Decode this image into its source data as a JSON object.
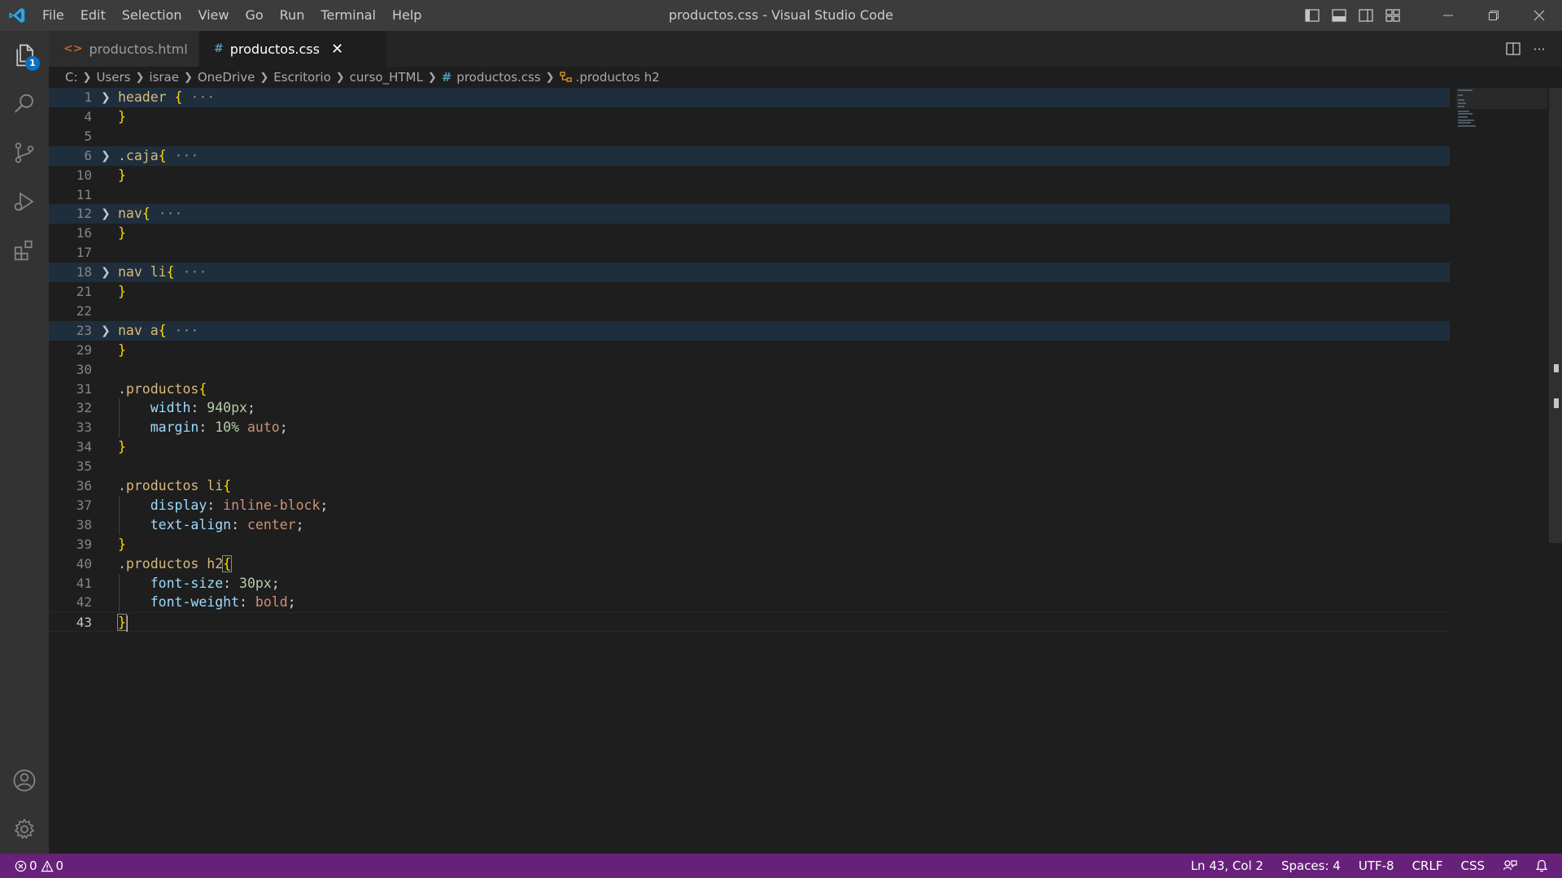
{
  "titlebar": {
    "menu": [
      "File",
      "Edit",
      "Selection",
      "View",
      "Go",
      "Run",
      "Terminal",
      "Help"
    ],
    "window_title": "productos.css - Visual Studio Code"
  },
  "activity_bar": {
    "explorer_badge": "1"
  },
  "tabs": [
    {
      "icon": "<>",
      "label": "productos.html",
      "modified": true,
      "active": false
    },
    {
      "icon": "#",
      "label": "productos.css",
      "modified": false,
      "active": true
    }
  ],
  "breadcrumb": [
    "C:",
    "Users",
    "israe",
    "OneDrive",
    "Escritorio",
    "curso_HTML",
    "productos.css",
    ".productos h2"
  ],
  "editor": {
    "lines": [
      {
        "num": "1",
        "folded": true,
        "tokens": [
          [
            "sel",
            "header "
          ],
          [
            "brace",
            "{"
          ],
          [
            "fold",
            " ···"
          ]
        ]
      },
      {
        "num": "4",
        "tokens": [
          [
            "brace",
            "}"
          ]
        ]
      },
      {
        "num": "5",
        "tokens": []
      },
      {
        "num": "6",
        "folded": true,
        "tokens": [
          [
            "sel",
            ".caja"
          ],
          [
            "brace",
            "{"
          ],
          [
            "fold",
            " ···"
          ]
        ]
      },
      {
        "num": "10",
        "tokens": [
          [
            "brace",
            "}"
          ]
        ]
      },
      {
        "num": "11",
        "tokens": []
      },
      {
        "num": "12",
        "folded": true,
        "tokens": [
          [
            "sel",
            "nav"
          ],
          [
            "brace",
            "{"
          ],
          [
            "fold",
            " ···"
          ]
        ]
      },
      {
        "num": "16",
        "tokens": [
          [
            "brace",
            "}"
          ]
        ]
      },
      {
        "num": "17",
        "tokens": []
      },
      {
        "num": "18",
        "folded": true,
        "tokens": [
          [
            "sel",
            "nav li"
          ],
          [
            "brace",
            "{"
          ],
          [
            "fold",
            " ···"
          ]
        ]
      },
      {
        "num": "21",
        "tokens": [
          [
            "brace",
            "}"
          ]
        ]
      },
      {
        "num": "22",
        "tokens": []
      },
      {
        "num": "23",
        "folded": true,
        "tokens": [
          [
            "sel",
            "nav a"
          ],
          [
            "brace",
            "{"
          ],
          [
            "fold",
            " ···"
          ]
        ]
      },
      {
        "num": "29",
        "tokens": [
          [
            "brace",
            "}"
          ]
        ]
      },
      {
        "num": "30",
        "tokens": []
      },
      {
        "num": "31",
        "tokens": [
          [
            "sel",
            ".productos"
          ],
          [
            "brace",
            "{"
          ]
        ]
      },
      {
        "num": "32",
        "tokens": [
          [
            "punc",
            "    "
          ],
          [
            "prop",
            "width"
          ],
          [
            "punc",
            ": "
          ],
          [
            "num",
            "940px"
          ],
          [
            "punc",
            ";"
          ]
        ]
      },
      {
        "num": "33",
        "tokens": [
          [
            "punc",
            "    "
          ],
          [
            "prop",
            "margin"
          ],
          [
            "punc",
            ": "
          ],
          [
            "num",
            "10%"
          ],
          [
            "punc",
            " "
          ],
          [
            "val",
            "auto"
          ],
          [
            "punc",
            ";"
          ]
        ]
      },
      {
        "num": "34",
        "tokens": [
          [
            "brace",
            "}"
          ]
        ]
      },
      {
        "num": "35",
        "tokens": []
      },
      {
        "num": "36",
        "tokens": [
          [
            "sel",
            ".productos li"
          ],
          [
            "brace",
            "{"
          ]
        ]
      },
      {
        "num": "37",
        "tokens": [
          [
            "punc",
            "    "
          ],
          [
            "prop",
            "display"
          ],
          [
            "punc",
            ": "
          ],
          [
            "val",
            "inline-block"
          ],
          [
            "punc",
            ";"
          ]
        ]
      },
      {
        "num": "38",
        "tokens": [
          [
            "punc",
            "    "
          ],
          [
            "prop",
            "text-align"
          ],
          [
            "punc",
            ": "
          ],
          [
            "val",
            "center"
          ],
          [
            "punc",
            ";"
          ]
        ]
      },
      {
        "num": "39",
        "tokens": [
          [
            "brace",
            "}"
          ]
        ]
      },
      {
        "num": "40",
        "tokens": [
          [
            "sel",
            ".productos h2"
          ],
          [
            "brace-match",
            "{"
          ]
        ]
      },
      {
        "num": "41",
        "tokens": [
          [
            "punc",
            "    "
          ],
          [
            "prop",
            "font-size"
          ],
          [
            "punc",
            ": "
          ],
          [
            "num",
            "30px"
          ],
          [
            "punc",
            ";"
          ]
        ]
      },
      {
        "num": "42",
        "tokens": [
          [
            "punc",
            "    "
          ],
          [
            "prop",
            "font-weight"
          ],
          [
            "punc",
            ": "
          ],
          [
            "val",
            "bold"
          ],
          [
            "punc",
            ";"
          ]
        ]
      },
      {
        "num": "43",
        "current": true,
        "tokens": [
          [
            "brace-match",
            "}"
          ]
        ]
      }
    ]
  },
  "statusbar": {
    "errors": "0",
    "warnings": "0",
    "position": "Ln 43, Col 2",
    "spaces": "Spaces: 4",
    "encoding": "UTF-8",
    "eol": "CRLF",
    "language": "CSS"
  },
  "colors": {
    "statusbar_bg": "#68217a",
    "titlebar_bg": "#3c3c3c",
    "editor_bg": "#1e1e1e",
    "vscode_blue": "#23a9f2"
  }
}
